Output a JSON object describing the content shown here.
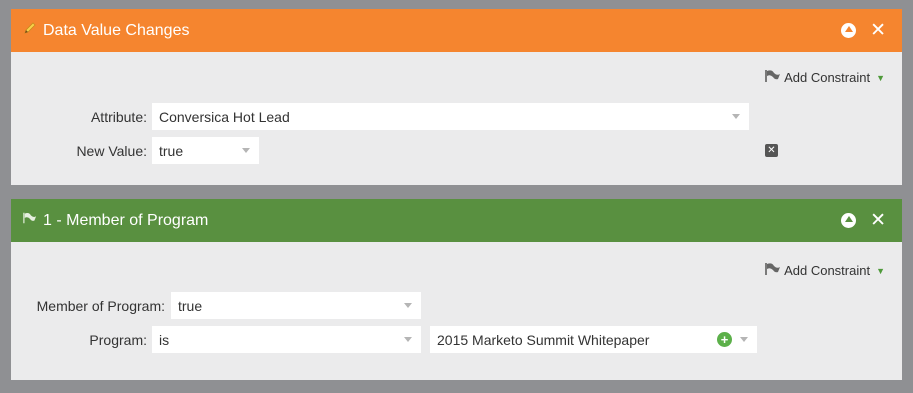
{
  "panels": [
    {
      "title": "Data Value Changes",
      "header_color": "#f5852f",
      "icon": "pencil-icon",
      "add_constraint": "Add Constraint",
      "fields": [
        {
          "label": "Attribute:",
          "value": "Conversica Hot Lead"
        },
        {
          "label": "New Value:",
          "value": "true"
        }
      ]
    },
    {
      "title": "1 - Member of Program",
      "header_color": "#599040",
      "icon": "flag-icon",
      "add_constraint": "Add Constraint",
      "fields": [
        {
          "label": "Member of Program:",
          "value": "true"
        },
        {
          "label": "Program:",
          "operator": "is",
          "value": "2015 Marketo Summit Whitepaper"
        }
      ]
    }
  ],
  "colors": {
    "background": "#8f9093",
    "panel_body": "#ebebec",
    "add_icon": "#5cb04a"
  }
}
